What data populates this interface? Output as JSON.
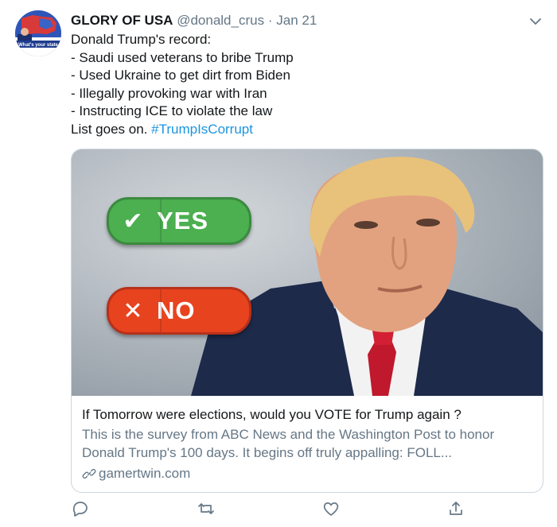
{
  "tweet": {
    "display_name": "GLORY OF USA",
    "handle": "@donald_crus",
    "separator": "·",
    "date": "Jan 21",
    "avatar_text": "What's your state",
    "body_lines": [
      "Donald Trump's record:",
      "- Saudi used veterans to bribe Trump",
      "- Used Ukraine to get dirt from Biden",
      "- Illegally provoking war with Iran",
      "- Instructing ICE to violate the law"
    ],
    "last_line_prefix": "List goes on. ",
    "hashtag": "#TrumpIsCorrupt"
  },
  "card": {
    "yes_label": "YES",
    "no_label": "NO",
    "yes_glyph": "✔",
    "no_glyph": "✕",
    "title": "If Tomorrow were elections, would you VOTE for Trump again ?",
    "description_lines": [
      "This is the survey from ABC News and the Washington Post to honor",
      "Donald Trump's 100 days. It begins off truly appalling:  FOLL..."
    ],
    "link": "gamertwin.com"
  },
  "actions": {
    "reply_icon": "reply-icon",
    "retweet_icon": "retweet-icon",
    "like_icon": "like-icon",
    "share_icon": "share-icon"
  },
  "colors": {
    "hashtag": "#1b95e0",
    "secondary": "#657786",
    "yes_green": "#4caf50",
    "no_red": "#e8431f"
  }
}
